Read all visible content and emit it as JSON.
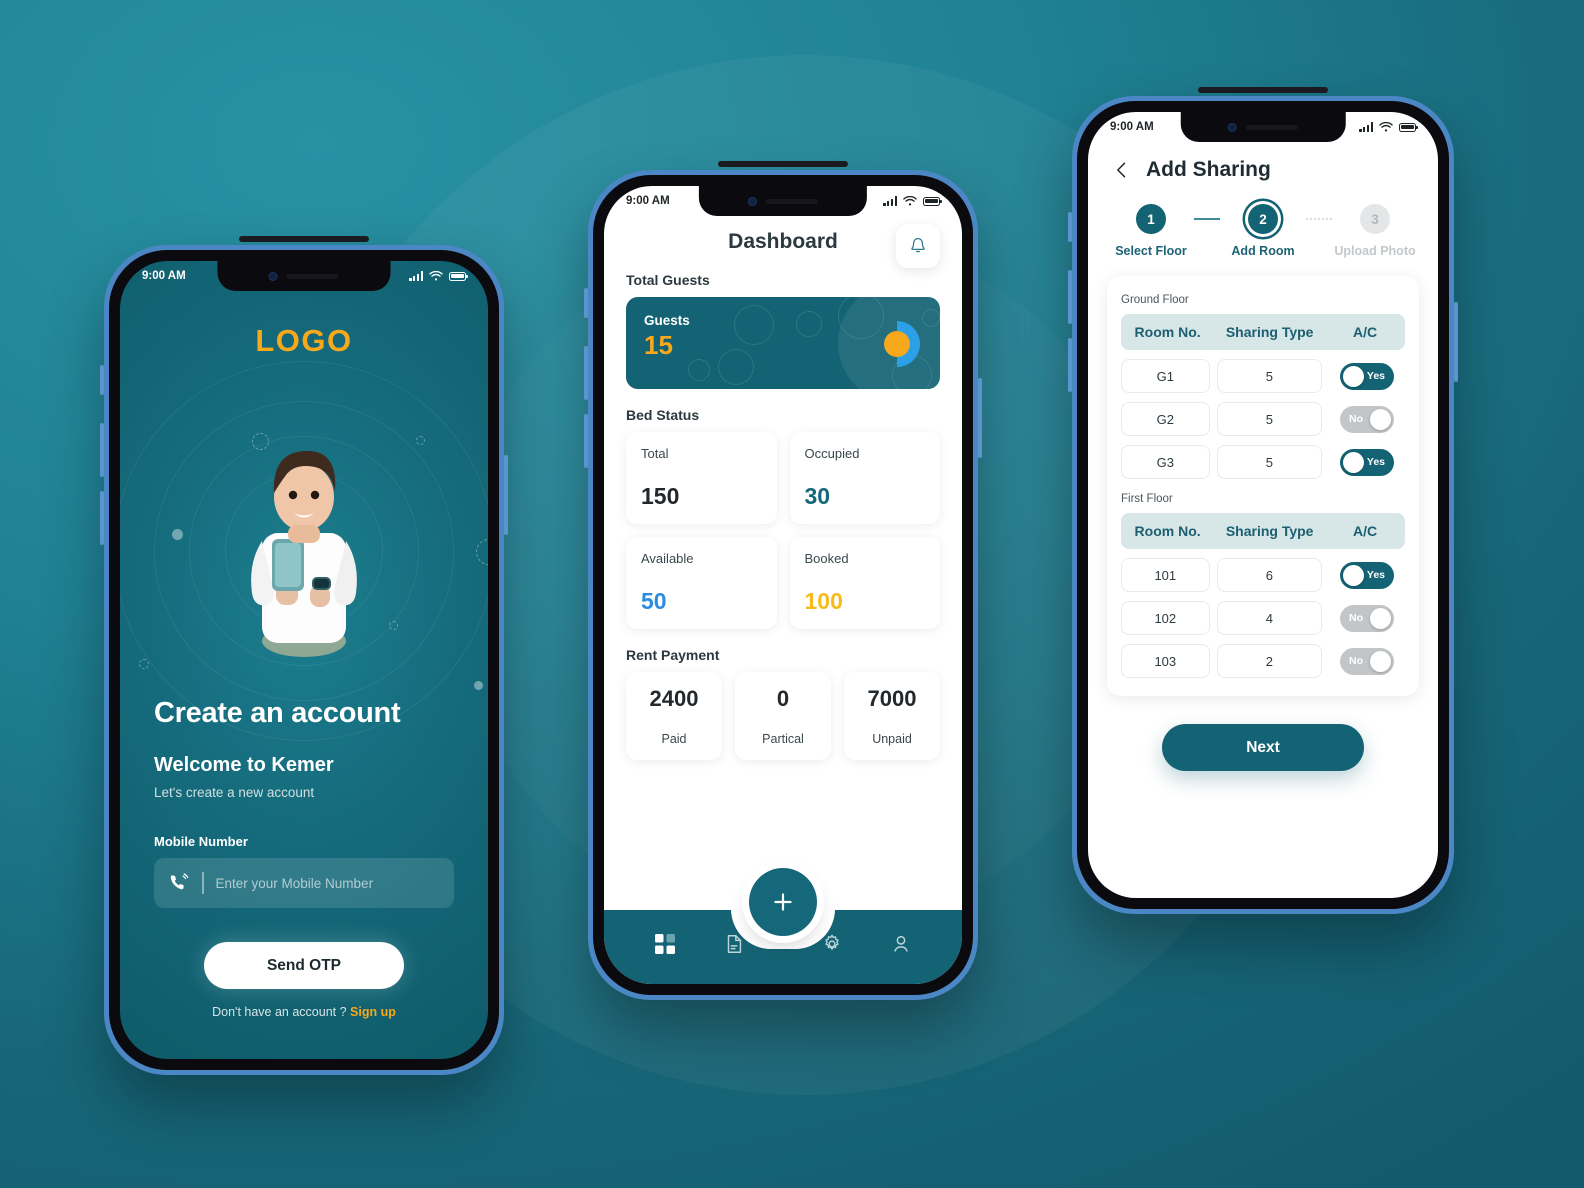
{
  "theme": {
    "teal_dark": "#146374",
    "teal_bg": "#1e8093",
    "accent_orange": "#f7a81b",
    "accent_blue": "#2b8ce0",
    "toggle_off": "#c3c6c8"
  },
  "phone1": {
    "status_bar": {
      "time": "9:00 AM",
      "signal_icon": "signal-bars-icon",
      "wifi_icon": "wifi-icon",
      "battery_icon": "battery-icon"
    },
    "logo": "LOGO",
    "hero_icon": "person-with-phone-illustration",
    "title": "Create an account",
    "welcome": "Welcome to Kemer",
    "subtitle": "Let's create a new account",
    "field_label": "Mobile Number",
    "field_icon": "phone-call-icon",
    "field_value": "",
    "field_placeholder": "Enter your Mobile Number",
    "primary_button": "Send OTP",
    "footer_text": "Don't have an account ?",
    "footer_link": "Sign up"
  },
  "phone2": {
    "status_bar": {
      "time": "9:00 AM",
      "signal_icon": "signal-bars-icon",
      "wifi_icon": "wifi-icon",
      "battery_icon": "battery-icon"
    },
    "title": "Dashboard",
    "bell_icon": "bell-icon",
    "sections": {
      "total_guests": "Total Guests",
      "bed_status": "Bed Status",
      "rent_payment": "Rent Payment"
    },
    "guests_card": {
      "label": "Guests",
      "value": "15"
    },
    "bed_status": [
      {
        "label": "Total",
        "value": "150",
        "color": "#23282c"
      },
      {
        "label": "Occupied",
        "value": "30",
        "color": "#15677a"
      },
      {
        "label": "Available",
        "value": "50",
        "color": "#2b8ce0"
      },
      {
        "label": "Booked",
        "value": "100",
        "color": "#f7bb1b"
      }
    ],
    "rent_payment": [
      {
        "value": "2400",
        "label": "Paid"
      },
      {
        "value": "0",
        "label": "Partical"
      },
      {
        "value": "7000",
        "label": "Unpaid"
      }
    ],
    "fab_icon": "plus-icon",
    "tabs": [
      {
        "name": "dashboard",
        "icon": "grid-icon",
        "active": true
      },
      {
        "name": "reports",
        "icon": "document-icon",
        "active": false
      },
      {
        "name": "settings",
        "icon": "gear-icon",
        "active": false
      },
      {
        "name": "profile",
        "icon": "person-icon",
        "active": false
      }
    ]
  },
  "phone3": {
    "status_bar": {
      "time": "9:00 AM",
      "signal_icon": "signal-bars-icon",
      "wifi_icon": "wifi-icon",
      "battery_icon": "battery-icon"
    },
    "back_icon": "chevron-left-icon",
    "title": "Add Sharing",
    "steps": [
      {
        "number": "1",
        "label": "Select Floor",
        "state": "done"
      },
      {
        "number": "2",
        "label": "Add Room",
        "state": "current"
      },
      {
        "number": "3",
        "label": "Upload Photo",
        "state": "inactive"
      }
    ],
    "columns": [
      "Room No.",
      "Sharing Type",
      "A/C"
    ],
    "floors": [
      {
        "name": "Ground Floor",
        "rows": [
          {
            "room": "G1",
            "sharing": "5",
            "ac": "Yes",
            "ac_on": true
          },
          {
            "room": "G2",
            "sharing": "5",
            "ac": "No",
            "ac_on": false
          },
          {
            "room": "G3",
            "sharing": "5",
            "ac": "Yes",
            "ac_on": true
          }
        ]
      },
      {
        "name": "First Floor",
        "rows": [
          {
            "room": "101",
            "sharing": "6",
            "ac": "Yes",
            "ac_on": true
          },
          {
            "room": "102",
            "sharing": "4",
            "ac": "No",
            "ac_on": false
          },
          {
            "room": "103",
            "sharing": "2",
            "ac": "No",
            "ac_on": false
          }
        ]
      }
    ],
    "next_button": "Next"
  }
}
